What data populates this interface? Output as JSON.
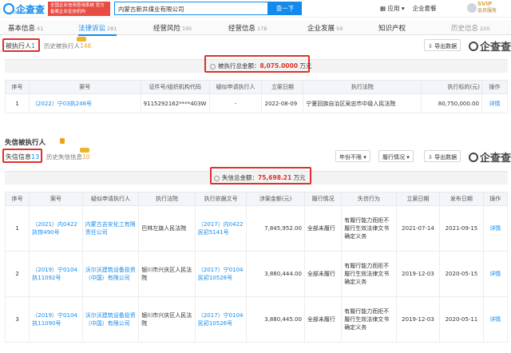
{
  "header": {
    "logo_text": "企查查",
    "logo_sub": "Qcc.com",
    "banner": "全国企业信用查询系统 官方备案企业征信机构",
    "search_value": "内蒙古新井煤业有限公司",
    "search_button": "查一下",
    "app_label": "应用",
    "suite_label": "企业套餐",
    "vip_label": "SVIP",
    "vip_center": "会员服务"
  },
  "tabs": [
    {
      "label": "基本信息",
      "count": "41"
    },
    {
      "label": "法律诉讼",
      "count": "281"
    },
    {
      "label": "经营风险",
      "count": "195"
    },
    {
      "label": "经营信息",
      "count": "178"
    },
    {
      "label": "企业发展",
      "count": "59"
    },
    {
      "label": "知识产权",
      "count": ""
    },
    {
      "label": "历史信息",
      "count": "220"
    }
  ],
  "executed": {
    "tab_label": "被执行人",
    "tab_count": "1",
    "history_label": "历史被执行人",
    "history_count": "146",
    "export": "导出数据",
    "watermark": "企查查",
    "summary_label": "被执行总金额：",
    "summary_amount": "8,075.0000",
    "summary_unit": "万元",
    "columns": [
      "序号",
      "案号",
      "证件号/组织机构代码",
      "疑似申请执行人",
      "立案日期",
      "执行法院",
      "执行标的(元)",
      "操作"
    ],
    "rows": [
      {
        "idx": "1",
        "case_no": "（2022）宁03执246号",
        "id_code": "9115292162****403W",
        "applicant": "-",
        "date": "2022-08-09",
        "court": "宁夏回族自治区吴忠市中级人民法院",
        "amount": "80,750,000.00",
        "action": "详情"
      }
    ]
  },
  "dishonest": {
    "title": "失信被执行人",
    "tab_label": "失信信息",
    "tab_count": "13",
    "history_label": "历史失信信息",
    "history_count": "10",
    "year_filter": "年份不限",
    "status_filter": "履行情况",
    "export": "导出数据",
    "watermark": "企查查",
    "summary_label": "失信总金额：",
    "summary_amount": "75,698.21",
    "summary_unit": "万元",
    "columns": [
      "序号",
      "案号",
      "疑似申请执行人",
      "执行法院",
      "执行依据文号",
      "涉案金额(元)",
      "履行情况",
      "失信行为",
      "立案日期",
      "发布日期",
      "操作"
    ],
    "rows": [
      {
        "idx": "1",
        "case_no": "（2021）内0422执恢490号",
        "applicant": "内蒙古吉安化工有限责任公司",
        "court": "巴林左旗人民法院",
        "basis": "（2017）内0422民初5141号",
        "amount": "7,845,952.00",
        "status": "全部未履行",
        "behavior": "有履行能力而拒不履行生效法律文书确定义务",
        "file_date": "2021-07-14",
        "pub_date": "2021-09-15",
        "action": "详情"
      },
      {
        "idx": "2",
        "case_no": "（2019）宁0104执11092号",
        "applicant": "沃尔沃建筑设备投资（中国）有限公司",
        "court": "银川市兴庆区人民法院",
        "basis": "（2017）宁0104民初10528号",
        "amount": "3,880,444.00",
        "status": "全部未履行",
        "behavior": "有履行能力而拒不履行生效法律文书确定义务",
        "file_date": "2019-12-03",
        "pub_date": "2020-05-15",
        "action": "详情"
      },
      {
        "idx": "3",
        "case_no": "（2019）宁0104执11090号",
        "applicant": "沃尔沃建筑设备投资（中国）有限公司",
        "court": "银川市兴庆区人民法院",
        "basis": "（2017）宁0104民初10526号",
        "amount": "3,880,445.00",
        "status": "全部未履行",
        "behavior": "有履行能力而拒不履行生效法律文书确定义务",
        "file_date": "2019-12-03",
        "pub_date": "2020-05-11",
        "action": "详情"
      }
    ]
  }
}
